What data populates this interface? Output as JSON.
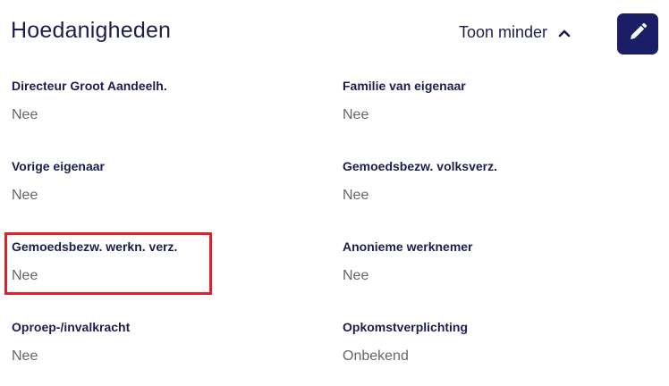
{
  "header": {
    "title": "Hoedanigheden",
    "toggle_label": "Toon minder",
    "toggle_icon": "chevron-up-icon",
    "edit_icon": "pencil-icon"
  },
  "fields": [
    {
      "label": "Directeur Groot Aandeelh.",
      "value": "Nee"
    },
    {
      "label": "Familie van eigenaar",
      "value": "Nee"
    },
    {
      "label": "Vorige eigenaar",
      "value": "Nee"
    },
    {
      "label": "Gemoedsbezw. volksverz.",
      "value": "Nee"
    },
    {
      "label": "Gemoedsbezw. werkn. verz.",
      "value": "Nee"
    },
    {
      "label": "Anonieme werknemer",
      "value": "Nee"
    },
    {
      "label": "Oproep-/invalkracht",
      "value": "Nee"
    },
    {
      "label": "Opkomstverplichting",
      "value": "Onbekend"
    }
  ],
  "colors": {
    "primary": "#1b1d66",
    "highlight": "#e0212c",
    "value_text": "#666666"
  }
}
